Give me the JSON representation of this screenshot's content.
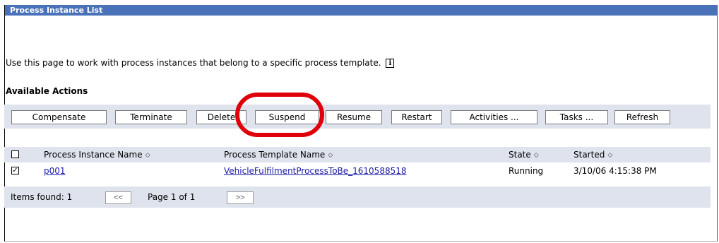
{
  "window": {
    "title": "Process Instance List"
  },
  "page": {
    "description": "Use this page to work with process instances that belong to a specific process template.",
    "info_icon_glyph": "i",
    "actions_heading": "Available Actions"
  },
  "actions": [
    {
      "label": "Compensate"
    },
    {
      "label": "Terminate"
    },
    {
      "label": "Delete"
    },
    {
      "label": "Suspend"
    },
    {
      "label": "Resume"
    },
    {
      "label": "Restart"
    },
    {
      "label": "Activities ..."
    },
    {
      "label": "Tasks ..."
    },
    {
      "label": "Refresh"
    }
  ],
  "highlight": {
    "target": "Suspend",
    "color": "#e0000a"
  },
  "table": {
    "columns": [
      {
        "label": "Process Instance Name",
        "sort_icon": "◇"
      },
      {
        "label": "Process Template Name",
        "sort_icon": "◇"
      },
      {
        "label": "State",
        "sort_icon": "◇"
      },
      {
        "label": "Started",
        "sort_icon": "◇"
      }
    ],
    "select_all_checked": false,
    "rows": [
      {
        "checked": true,
        "check_glyph": "✓",
        "instance_name": "p001",
        "template_name": "VehicleFulfilmentProcessToBe_1610588518",
        "state": "Running",
        "started": "3/10/06 4:15:38 PM"
      }
    ]
  },
  "footer": {
    "items_found": "Items found: 1",
    "prev_label": "<<",
    "page_label": "Page 1 of 1",
    "next_label": ">>"
  },
  "colors": {
    "title_bar": "#4a72b8",
    "bar_background": "#dfe3ed",
    "link": "#1a1aa6"
  }
}
